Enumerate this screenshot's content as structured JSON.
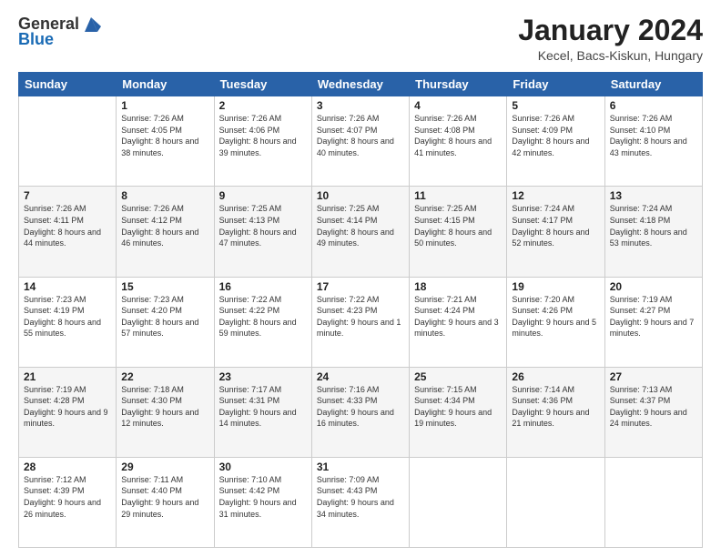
{
  "logo": {
    "general": "General",
    "blue": "Blue"
  },
  "header": {
    "title": "January 2024",
    "location": "Kecel, Bacs-Kiskun, Hungary"
  },
  "days_of_week": [
    "Sunday",
    "Monday",
    "Tuesday",
    "Wednesday",
    "Thursday",
    "Friday",
    "Saturday"
  ],
  "weeks": [
    [
      {
        "day": "",
        "sunrise": "",
        "sunset": "",
        "daylight": ""
      },
      {
        "day": "1",
        "sunrise": "Sunrise: 7:26 AM",
        "sunset": "Sunset: 4:05 PM",
        "daylight": "Daylight: 8 hours and 38 minutes."
      },
      {
        "day": "2",
        "sunrise": "Sunrise: 7:26 AM",
        "sunset": "Sunset: 4:06 PM",
        "daylight": "Daylight: 8 hours and 39 minutes."
      },
      {
        "day": "3",
        "sunrise": "Sunrise: 7:26 AM",
        "sunset": "Sunset: 4:07 PM",
        "daylight": "Daylight: 8 hours and 40 minutes."
      },
      {
        "day": "4",
        "sunrise": "Sunrise: 7:26 AM",
        "sunset": "Sunset: 4:08 PM",
        "daylight": "Daylight: 8 hours and 41 minutes."
      },
      {
        "day": "5",
        "sunrise": "Sunrise: 7:26 AM",
        "sunset": "Sunset: 4:09 PM",
        "daylight": "Daylight: 8 hours and 42 minutes."
      },
      {
        "day": "6",
        "sunrise": "Sunrise: 7:26 AM",
        "sunset": "Sunset: 4:10 PM",
        "daylight": "Daylight: 8 hours and 43 minutes."
      }
    ],
    [
      {
        "day": "7",
        "sunrise": "Sunrise: 7:26 AM",
        "sunset": "Sunset: 4:11 PM",
        "daylight": "Daylight: 8 hours and 44 minutes."
      },
      {
        "day": "8",
        "sunrise": "Sunrise: 7:26 AM",
        "sunset": "Sunset: 4:12 PM",
        "daylight": "Daylight: 8 hours and 46 minutes."
      },
      {
        "day": "9",
        "sunrise": "Sunrise: 7:25 AM",
        "sunset": "Sunset: 4:13 PM",
        "daylight": "Daylight: 8 hours and 47 minutes."
      },
      {
        "day": "10",
        "sunrise": "Sunrise: 7:25 AM",
        "sunset": "Sunset: 4:14 PM",
        "daylight": "Daylight: 8 hours and 49 minutes."
      },
      {
        "day": "11",
        "sunrise": "Sunrise: 7:25 AM",
        "sunset": "Sunset: 4:15 PM",
        "daylight": "Daylight: 8 hours and 50 minutes."
      },
      {
        "day": "12",
        "sunrise": "Sunrise: 7:24 AM",
        "sunset": "Sunset: 4:17 PM",
        "daylight": "Daylight: 8 hours and 52 minutes."
      },
      {
        "day": "13",
        "sunrise": "Sunrise: 7:24 AM",
        "sunset": "Sunset: 4:18 PM",
        "daylight": "Daylight: 8 hours and 53 minutes."
      }
    ],
    [
      {
        "day": "14",
        "sunrise": "Sunrise: 7:23 AM",
        "sunset": "Sunset: 4:19 PM",
        "daylight": "Daylight: 8 hours and 55 minutes."
      },
      {
        "day": "15",
        "sunrise": "Sunrise: 7:23 AM",
        "sunset": "Sunset: 4:20 PM",
        "daylight": "Daylight: 8 hours and 57 minutes."
      },
      {
        "day": "16",
        "sunrise": "Sunrise: 7:22 AM",
        "sunset": "Sunset: 4:22 PM",
        "daylight": "Daylight: 8 hours and 59 minutes."
      },
      {
        "day": "17",
        "sunrise": "Sunrise: 7:22 AM",
        "sunset": "Sunset: 4:23 PM",
        "daylight": "Daylight: 9 hours and 1 minute."
      },
      {
        "day": "18",
        "sunrise": "Sunrise: 7:21 AM",
        "sunset": "Sunset: 4:24 PM",
        "daylight": "Daylight: 9 hours and 3 minutes."
      },
      {
        "day": "19",
        "sunrise": "Sunrise: 7:20 AM",
        "sunset": "Sunset: 4:26 PM",
        "daylight": "Daylight: 9 hours and 5 minutes."
      },
      {
        "day": "20",
        "sunrise": "Sunrise: 7:19 AM",
        "sunset": "Sunset: 4:27 PM",
        "daylight": "Daylight: 9 hours and 7 minutes."
      }
    ],
    [
      {
        "day": "21",
        "sunrise": "Sunrise: 7:19 AM",
        "sunset": "Sunset: 4:28 PM",
        "daylight": "Daylight: 9 hours and 9 minutes."
      },
      {
        "day": "22",
        "sunrise": "Sunrise: 7:18 AM",
        "sunset": "Sunset: 4:30 PM",
        "daylight": "Daylight: 9 hours and 12 minutes."
      },
      {
        "day": "23",
        "sunrise": "Sunrise: 7:17 AM",
        "sunset": "Sunset: 4:31 PM",
        "daylight": "Daylight: 9 hours and 14 minutes."
      },
      {
        "day": "24",
        "sunrise": "Sunrise: 7:16 AM",
        "sunset": "Sunset: 4:33 PM",
        "daylight": "Daylight: 9 hours and 16 minutes."
      },
      {
        "day": "25",
        "sunrise": "Sunrise: 7:15 AM",
        "sunset": "Sunset: 4:34 PM",
        "daylight": "Daylight: 9 hours and 19 minutes."
      },
      {
        "day": "26",
        "sunrise": "Sunrise: 7:14 AM",
        "sunset": "Sunset: 4:36 PM",
        "daylight": "Daylight: 9 hours and 21 minutes."
      },
      {
        "day": "27",
        "sunrise": "Sunrise: 7:13 AM",
        "sunset": "Sunset: 4:37 PM",
        "daylight": "Daylight: 9 hours and 24 minutes."
      }
    ],
    [
      {
        "day": "28",
        "sunrise": "Sunrise: 7:12 AM",
        "sunset": "Sunset: 4:39 PM",
        "daylight": "Daylight: 9 hours and 26 minutes."
      },
      {
        "day": "29",
        "sunrise": "Sunrise: 7:11 AM",
        "sunset": "Sunset: 4:40 PM",
        "daylight": "Daylight: 9 hours and 29 minutes."
      },
      {
        "day": "30",
        "sunrise": "Sunrise: 7:10 AM",
        "sunset": "Sunset: 4:42 PM",
        "daylight": "Daylight: 9 hours and 31 minutes."
      },
      {
        "day": "31",
        "sunrise": "Sunrise: 7:09 AM",
        "sunset": "Sunset: 4:43 PM",
        "daylight": "Daylight: 9 hours and 34 minutes."
      },
      {
        "day": "",
        "sunrise": "",
        "sunset": "",
        "daylight": ""
      },
      {
        "day": "",
        "sunrise": "",
        "sunset": "",
        "daylight": ""
      },
      {
        "day": "",
        "sunrise": "",
        "sunset": "",
        "daylight": ""
      }
    ]
  ]
}
